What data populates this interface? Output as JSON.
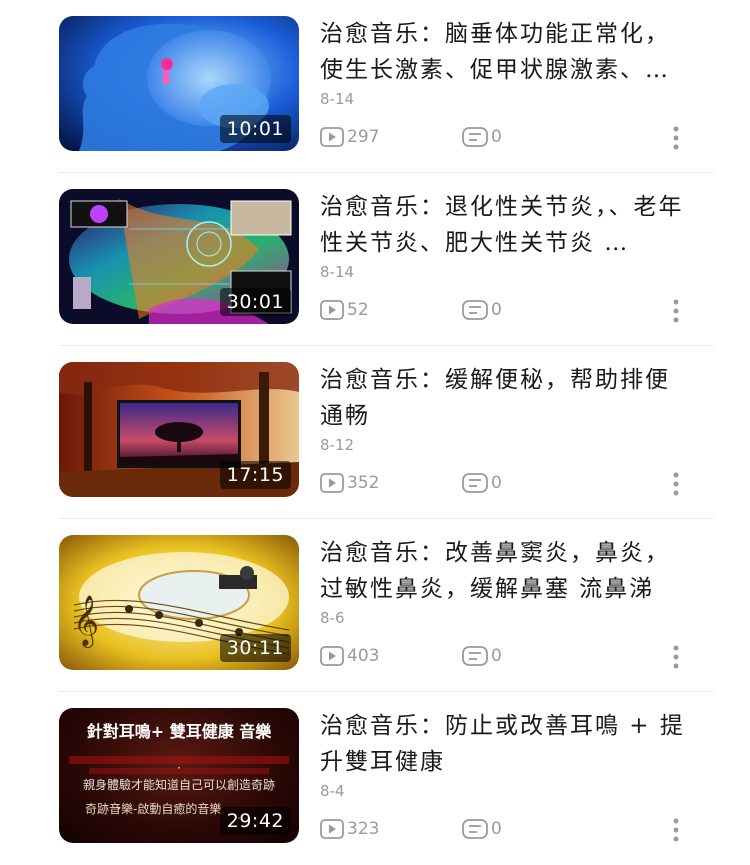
{
  "videos": [
    {
      "title": "治愈音乐：脑垂体功能正常化，使生长激素、促甲状腺激素、…",
      "date": "8-14",
      "duration": "10:01",
      "views": "297",
      "comments": "0",
      "thumb_icon": "brain-head-thumbnail"
    },
    {
      "title": "治愈音乐：退化性关节炎，、老年性关节炎、肥大性关节炎 …",
      "date": "8-14",
      "duration": "30:01",
      "views": "52",
      "comments": "0",
      "thumb_icon": "neon-tech-thumbnail"
    },
    {
      "title": "治愈音乐：缓解便秘，帮助排便通畅",
      "date": "8-12",
      "duration": "17:15",
      "views": "352",
      "comments": "0",
      "thumb_icon": "autumn-tree-thumbnail"
    },
    {
      "title": "治愈音乐：改善鼻窦炎，鼻炎，过敏性鼻炎，缓解鼻塞 流鼻涕",
      "date": "8-6",
      "duration": "30:11",
      "views": "403",
      "comments": "0",
      "thumb_icon": "music-staff-thumbnail"
    },
    {
      "title": "治愈音乐：防止或改善耳鳴 + 提升雙耳健康",
      "date": "8-4",
      "duration": "29:42",
      "views": "323",
      "comments": "0",
      "thumb_icon": "text-card-thumbnail",
      "thumb_text": {
        "headline": "針對耳鳴+ 雙耳健康 音樂",
        "line2": "親身體驗才能知道自己可以創造奇跡",
        "line3": "奇跡音樂-啟動自癒的音樂"
      }
    }
  ],
  "colors": {
    "meta_gray": "#9a9a9a",
    "divider": "#ececec",
    "title": "#1a1a1a"
  }
}
